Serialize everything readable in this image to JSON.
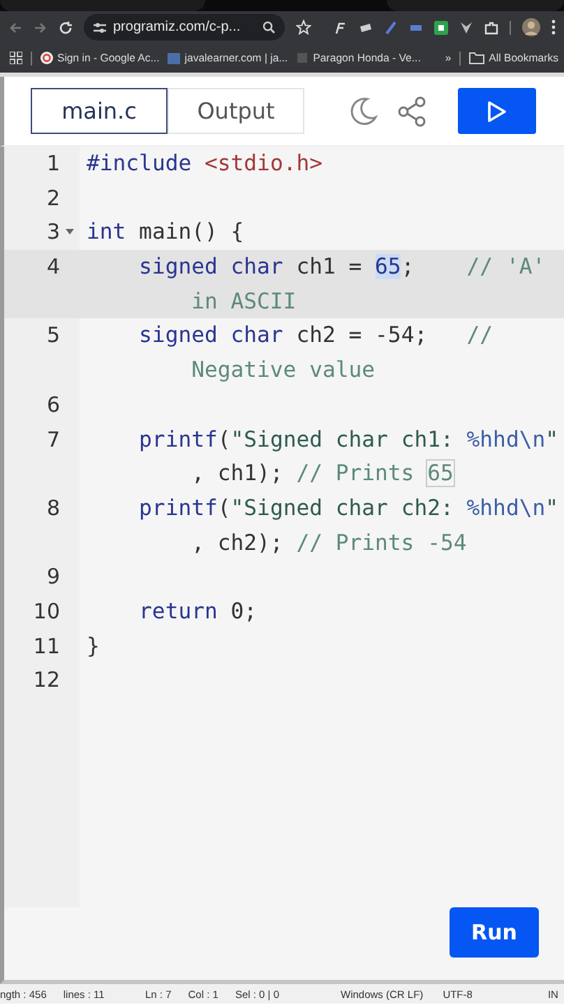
{
  "browser": {
    "url": "programiz.com/c-p...",
    "bookmarks": [
      {
        "label": "Sign in - Google Ac..."
      },
      {
        "label": "javalearner.com | ja..."
      },
      {
        "label": "Paragon Honda - Ve..."
      }
    ],
    "overflow": "»",
    "all_bookmarks": "All Bookmarks"
  },
  "tabs": [
    {
      "label": "main.c",
      "selected": true
    },
    {
      "label": "Output",
      "selected": false
    }
  ],
  "code": [
    {
      "number": "1",
      "foldable": false,
      "active": false,
      "rows": [
        {
          "indent": false,
          "tokens": [
            {
              "kind": "meta",
              "text": "#include "
            },
            {
              "kind": "header",
              "text": "<stdio.h>"
            }
          ]
        }
      ]
    },
    {
      "number": "2",
      "foldable": false,
      "active": false
    },
    {
      "number": "3",
      "foldable": true,
      "active": false,
      "rows": [
        {
          "indent": false,
          "tokens": [
            {
              "kind": "keyword",
              "text": "int"
            },
            {
              "kind": "plain",
              "text": " main() {"
            }
          ]
        }
      ]
    },
    {
      "number": "4",
      "foldable": false,
      "active": true,
      "rows": [
        {
          "indent": true,
          "tokens": [
            {
              "kind": "keyword",
              "text": "signed char"
            },
            {
              "kind": "plain",
              "text": " ch1 = "
            },
            {
              "kind": "number",
              "text": "65",
              "selected": true
            },
            {
              "kind": "plain",
              "text": ";    "
            },
            {
              "kind": "comment",
              "text": "// 'A'"
            }
          ]
        },
        {
          "indent": false,
          "tokens": [
            {
              "kind": "comment",
              "text": "in ASCII"
            }
          ]
        }
      ]
    },
    {
      "number": "5",
      "foldable": false,
      "active": false,
      "rows": [
        {
          "indent": true,
          "tokens": [
            {
              "kind": "keyword",
              "text": "signed char"
            },
            {
              "kind": "plain",
              "text": " ch2 = -54;   "
            },
            {
              "kind": "comment",
              "text": "//"
            }
          ]
        },
        {
          "indent": false,
          "tokens": [
            {
              "kind": "comment",
              "text": "Negative value"
            }
          ]
        }
      ]
    },
    {
      "number": "6",
      "foldable": false,
      "active": false
    },
    {
      "number": "7",
      "foldable": false,
      "active": false,
      "rows": [
        {
          "indent": true,
          "tokens": [
            {
              "kind": "keyword",
              "text": "printf"
            },
            {
              "kind": "plain",
              "text": "("
            },
            {
              "kind": "string",
              "text": "\"Signed char ch1: "
            },
            {
              "kind": "format",
              "text": "%hhd\\n"
            },
            {
              "kind": "string",
              "text": "\""
            }
          ]
        },
        {
          "indent": false,
          "tokens": [
            {
              "kind": "plain",
              "text": ", ch1); "
            },
            {
              "kind": "comment",
              "text": "// Prints "
            },
            {
              "kind": "comment",
              "text": "65",
              "boxed": true
            }
          ]
        }
      ]
    },
    {
      "number": "8",
      "foldable": false,
      "active": false,
      "rows": [
        {
          "indent": true,
          "tokens": [
            {
              "kind": "keyword",
              "text": "printf"
            },
            {
              "kind": "plain",
              "text": "("
            },
            {
              "kind": "string",
              "text": "\"Signed char ch2: "
            },
            {
              "kind": "format",
              "text": "%hhd\\n"
            },
            {
              "kind": "string",
              "text": "\""
            }
          ]
        },
        {
          "indent": false,
          "tokens": [
            {
              "kind": "plain",
              "text": ", ch2); "
            },
            {
              "kind": "comment",
              "text": "// Prints -54"
            }
          ]
        }
      ]
    },
    {
      "number": "9",
      "foldable": false,
      "active": false
    },
    {
      "number": "10",
      "foldable": false,
      "active": false,
      "rows": [
        {
          "indent": true,
          "tokens": [
            {
              "kind": "keyword",
              "text": "return"
            },
            {
              "kind": "plain",
              "text": " 0;"
            }
          ]
        }
      ]
    },
    {
      "number": "11",
      "foldable": false,
      "active": false,
      "rows": [
        {
          "indent": false,
          "tokens": [
            {
              "kind": "plain",
              "text": "}"
            }
          ]
        }
      ]
    },
    {
      "number": "12",
      "foldable": false,
      "active": false
    }
  ],
  "run_button": "Run",
  "status_bar": {
    "left": [
      "ngth : 456",
      "lines : 11"
    ],
    "middle": [
      "Ln : 7",
      "Col : 1",
      "Sel : 0 | 0"
    ],
    "right": [
      "Windows (CR LF)",
      "UTF-8",
      "IN"
    ]
  }
}
